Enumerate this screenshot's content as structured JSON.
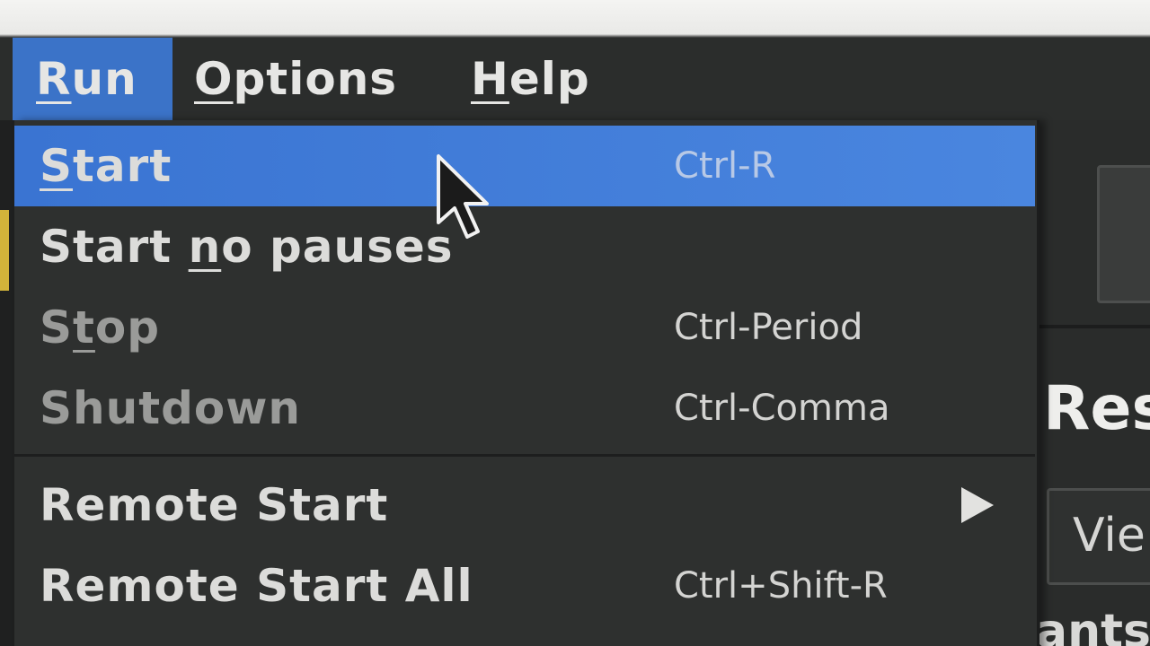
{
  "menubar": {
    "run_label": "Run",
    "options_label": "Options",
    "help_label": "Help"
  },
  "run_menu": {
    "items": [
      {
        "label": "Start",
        "shortcut": "Ctrl-R",
        "state": "highlighted"
      },
      {
        "label": "Start no pauses",
        "shortcut": "",
        "state": "enabled"
      },
      {
        "label": "Stop",
        "shortcut": "Ctrl-Period",
        "state": "disabled"
      },
      {
        "label": "Shutdown",
        "shortcut": "Ctrl-Comma",
        "state": "disabled"
      },
      {
        "label": "Remote Start",
        "shortcut": "",
        "state": "enabled",
        "submenu": true
      },
      {
        "label": "Remote Start All",
        "shortcut": "Ctrl+Shift-R",
        "state": "enabled"
      }
    ]
  },
  "background_window": {
    "heading_fragment": "Res",
    "button_fragment": "Vie",
    "bottom_text_fragment": "ants"
  },
  "colors": {
    "menubar_bg": "#2b2d2c",
    "highlight": "#3a74d2",
    "menu_bg": "#2e302f",
    "text": "#dcdcda",
    "disabled_text": "#9a9b99"
  },
  "icons": {
    "cursor": "arrow-cursor-icon",
    "submenu_arrow": "triangle-right-icon"
  }
}
